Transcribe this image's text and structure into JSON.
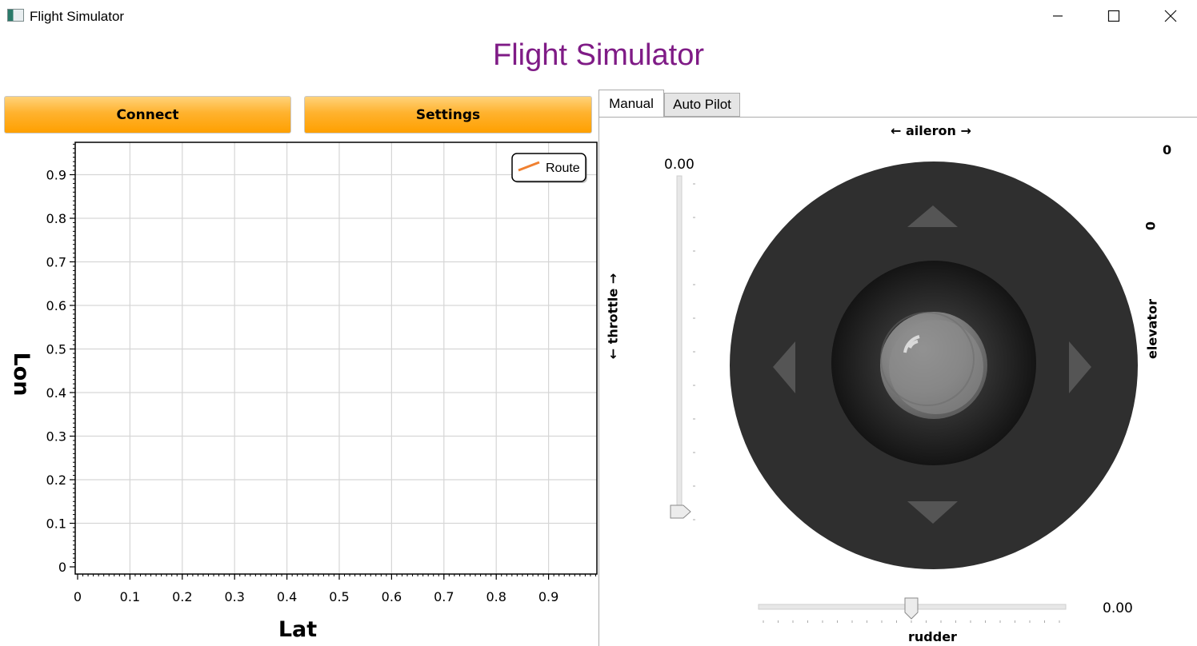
{
  "window": {
    "title": "Flight Simulator",
    "minimize_icon": "minimize-icon",
    "maximize_icon": "maximize-icon",
    "close_icon": "close-icon"
  },
  "header": {
    "title": "Flight Simulator"
  },
  "toolbar": {
    "connect_label": "Connect",
    "settings_label": "Settings"
  },
  "chart_data": {
    "type": "line",
    "xlabel": "Lat",
    "ylabel": "Lon",
    "xlim": [
      0,
      1
    ],
    "ylim": [
      0,
      1
    ],
    "x_ticks": [
      "0",
      "0.1",
      "0.2",
      "0.3",
      "0.4",
      "0.5",
      "0.6",
      "0.7",
      "0.8",
      "0.9"
    ],
    "y_ticks": [
      "0",
      "0.1",
      "0.2",
      "0.3",
      "0.4",
      "0.5",
      "0.6",
      "0.7",
      "0.8",
      "0.9"
    ],
    "grid": true,
    "legend_position": "top-right",
    "series": [
      {
        "name": "Route",
        "color": "#f08030",
        "x": [],
        "y": []
      }
    ]
  },
  "tabs": {
    "manual_label": "Manual",
    "autopilot_label": "Auto Pilot"
  },
  "controls": {
    "aileron_label": "← aileron →",
    "aileron_value": "0",
    "elevator_label": "elevator",
    "elevator_value": "0",
    "throttle_label": "← throttle →",
    "throttle_value": "0.00",
    "throttle_level": 0.0,
    "rudder_label": "rudder",
    "rudder_value": "0.00",
    "rudder_level": 0.5
  },
  "colors": {
    "title": "#7f1b86",
    "button": "#ffb22e",
    "joystick_outer": "#2f2f2f"
  }
}
